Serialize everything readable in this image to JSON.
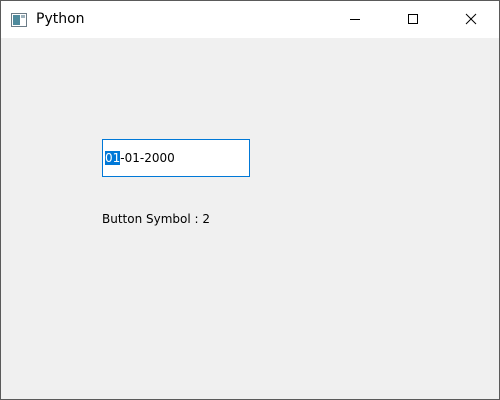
{
  "window": {
    "title": "Python",
    "icon": "python-app-icon",
    "controls": {
      "minimize_icon": "minimize-icon",
      "maximize_icon": "maximize-icon",
      "close_icon": "close-icon"
    }
  },
  "date_edit": {
    "selected_section": "01",
    "remaining_text": "-01-2000",
    "focus_color": "#0078d7"
  },
  "label": {
    "text": "Button Symbol : 2"
  }
}
